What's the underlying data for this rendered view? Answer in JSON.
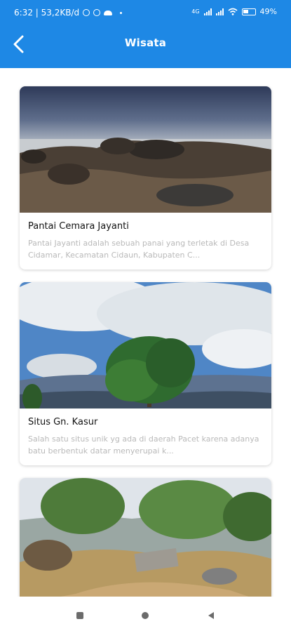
{
  "status_bar": {
    "time_speed": "6:32 | 53,2KB/d",
    "network_label": "4G",
    "battery_level": "49",
    "icons": [
      "alarm-icon",
      "app-icon",
      "cloud-icon",
      "dot-icon",
      "signal-icon",
      "wifi-icon",
      "battery-icon"
    ]
  },
  "header": {
    "title": "Wisata",
    "back_icon": "back-arrow-icon",
    "background_color": "#1e88e5"
  },
  "places": [
    {
      "name": "Pantai Cemara Jayanti",
      "description": "Pantai Jayanti adalah sebuah panai yang terletak di Desa Cidamar, Kecamatan Cidaun, Kabupaten C...",
      "image": "beach-rocks-photo"
    },
    {
      "name": "Situs Gn. Kasur",
      "description": "Salah satu situs unik yg ada di daerah Pacet karena adanya batu berbentuk datar menyerupai k...",
      "image": "mountain-tree-photo"
    },
    {
      "name": "",
      "description": "",
      "image": "hilltop-site-photo"
    }
  ],
  "nav_bar": {
    "icons": [
      "recent-apps-icon",
      "home-icon",
      "back-icon"
    ]
  }
}
